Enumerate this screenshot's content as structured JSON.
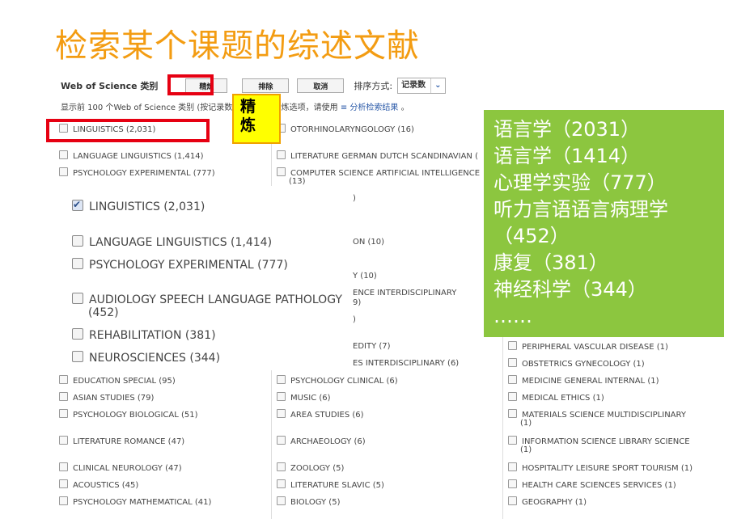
{
  "slide_title": "检索某个课题的综述文献",
  "toolbar": {
    "category_label": "Web of Science 类别",
    "refine_label": "精炼",
    "exclude_label": "排除",
    "cancel_label": "取消",
    "sort_label": "排序方式:",
    "sort_value": "记录数"
  },
  "info": {
    "text_before": "显示前 100 个Web of Science 类别 (按记录数",
    "text_after": "多精炼选项，请使用",
    "link": "分析检索结果",
    "text_end": "。"
  },
  "refine_tip": "精\n炼",
  "columns": {
    "col1": [
      "LINGUISTICS (2,031)",
      "LANGUAGE LINGUISTICS (1,414)",
      "PSYCHOLOGY EXPERIMENTAL (777)",
      "EDUCATION SPECIAL (95)",
      "ASIAN STUDIES (79)",
      "PSYCHOLOGY BIOLOGICAL (51)",
      "LITERATURE ROMANCE (47)",
      "CLINICAL NEUROLOGY (47)",
      "ACOUSTICS (45)",
      "PSYCHOLOGY MATHEMATICAL (41)"
    ],
    "col2": [
      "OTORHINOLARYNGOLOGY (16)",
      "LITERATURE GERMAN DUTCH SCANDINAVIAN (",
      "COMPUTER SCIENCE ARTIFICIAL INTELLIGENCE",
      "(13)",
      ")",
      "ON (10)",
      "Y (10)",
      "ENCE INTERDISCIPLINARY",
      "9)",
      ")",
      "EDITY (7)",
      "ES INTERDISCIPLINARY (6)",
      "PSYCHOLOGY CLINICAL (6)",
      "MUSIC (6)",
      "AREA STUDIES (6)",
      "ARCHAEOLOGY (6)",
      "ZOOLOGY (5)",
      "LITERATURE SLAVIC (5)",
      "BIOLOGY (5)"
    ],
    "col3": [
      "PERIPHERAL VASCULAR DISEASE (1)",
      "OBSTETRICS GYNECOLOGY (1)",
      "MEDICINE GENERAL INTERNAL (1)",
      "MEDICAL ETHICS (1)",
      "MATERIALS SCIENCE MULTIDISCIPLINARY",
      "(1)",
      "INFORMATION SCIENCE LIBRARY SCIENCE",
      "(1)",
      "HOSPITALITY LEISURE SPORT TOURISM (1)",
      "HEALTH CARE SCIENCES SERVICES (1)",
      "GEOGRAPHY (1)"
    ]
  },
  "zoom": {
    "items": [
      "LINGUISTICS (2,031)",
      "LANGUAGE LINGUISTICS (1,414)",
      "PSYCHOLOGY EXPERIMENTAL (777)",
      "AUDIOLOGY SPEECH LANGUAGE PATHOLOGY",
      "(452)",
      "REHABILITATION (381)",
      "NEUROSCIENCES (344)"
    ]
  },
  "green_box": {
    "lines": [
      "语言学（2031）",
      "语言学（1414）",
      "心理学实验（777）",
      "听力言语语言病理学",
      "（452）",
      "康复（381）",
      "神经科学（344）",
      "……"
    ]
  },
  "colors": {
    "title": "#f39c12",
    "highlight_red": "#e60012",
    "tip_yellow": "#ffff00",
    "green_box": "#8cc63f",
    "link_blue": "#2b5aa8"
  }
}
